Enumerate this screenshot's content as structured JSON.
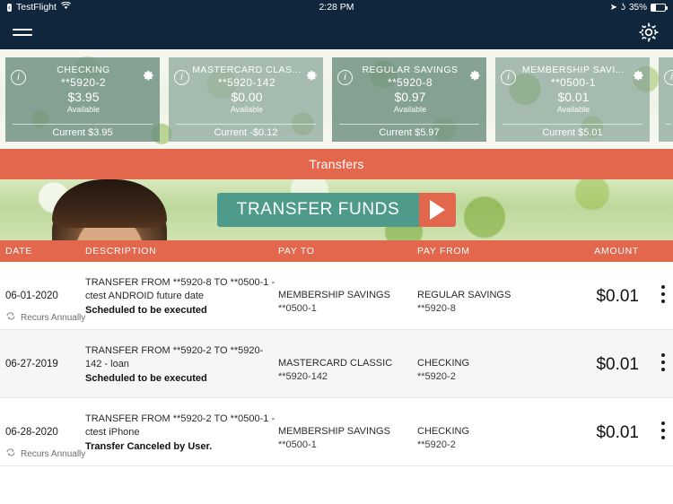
{
  "statusbar": {
    "back_label": "‹",
    "app_name": "TestFlight",
    "wifi_icon": "wifi-icon",
    "time": "2:28 PM",
    "location_glyph": "➤",
    "bluetooth_glyph": "ʖ",
    "battery_percent": "35%"
  },
  "navbar": {
    "menu_icon": "hamburger-menu-icon",
    "settings_icon": "gear-icon"
  },
  "accounts": [
    {
      "name": "CHECKING",
      "number": "**5920-2",
      "available_amount": "$3.95",
      "available_label": "Available",
      "current": "Current $3.95"
    },
    {
      "name": "MASTERCARD CLAS...",
      "number": "**5920-142",
      "available_amount": "$0.00",
      "available_label": "Available",
      "current": "Current -$0.12"
    },
    {
      "name": "REGULAR SAVINGS",
      "number": "**5920-8",
      "available_amount": "$0.97",
      "available_label": "Available",
      "current": "Current $5.97"
    },
    {
      "name": "MEMBERSHIP SAVI...",
      "number": "**0500-1",
      "available_amount": "$0.01",
      "available_label": "Available",
      "current": "Current $5.01"
    }
  ],
  "banner": {
    "title": "Transfers"
  },
  "hero": {
    "transfer_button_label": "TRANSFER FUNDS",
    "play_icon": "play-arrow-icon"
  },
  "table": {
    "headers": {
      "date": "DATE",
      "description": "DESCRIPTION",
      "pay_to": "PAY TO",
      "pay_from": "PAY FROM",
      "amount": "AMOUNT"
    },
    "rows": [
      {
        "date": "06-01-2020",
        "description": "TRANSFER FROM **5920-8 TO **0500-1 - ctest ANDROID future date",
        "status": "Scheduled to be executed",
        "pay_to_name": "MEMBERSHIP SAVINGS",
        "pay_to_number": "**0500-1",
        "pay_from_name": "REGULAR SAVINGS",
        "pay_from_number": "**5920-8",
        "amount": "$0.01",
        "recurs": "Recurs Annually"
      },
      {
        "date": "06-27-2019",
        "description": "TRANSFER FROM **5920-2 TO **5920-142 - loan",
        "status": "Scheduled to be executed",
        "pay_to_name": "MASTERCARD CLASSIC",
        "pay_to_number": "**5920-142",
        "pay_from_name": "CHECKING",
        "pay_from_number": "**5920-2",
        "amount": "$0.01",
        "recurs": ""
      },
      {
        "date": "06-28-2020",
        "description": "TRANSFER FROM **5920-2 TO **0500-1 - ctest iPhone",
        "status": "Transfer Canceled by User.",
        "pay_to_name": "MEMBERSHIP SAVINGS",
        "pay_to_number": "**0500-1",
        "pay_from_name": "CHECKING",
        "pay_from_number": "**5920-2",
        "amount": "$0.01",
        "recurs": "Recurs Annually"
      }
    ]
  },
  "colors": {
    "navy": "#10263c",
    "orange": "#e2674d",
    "teal": "#4f9b8b",
    "card_green": "#6c8f80"
  }
}
